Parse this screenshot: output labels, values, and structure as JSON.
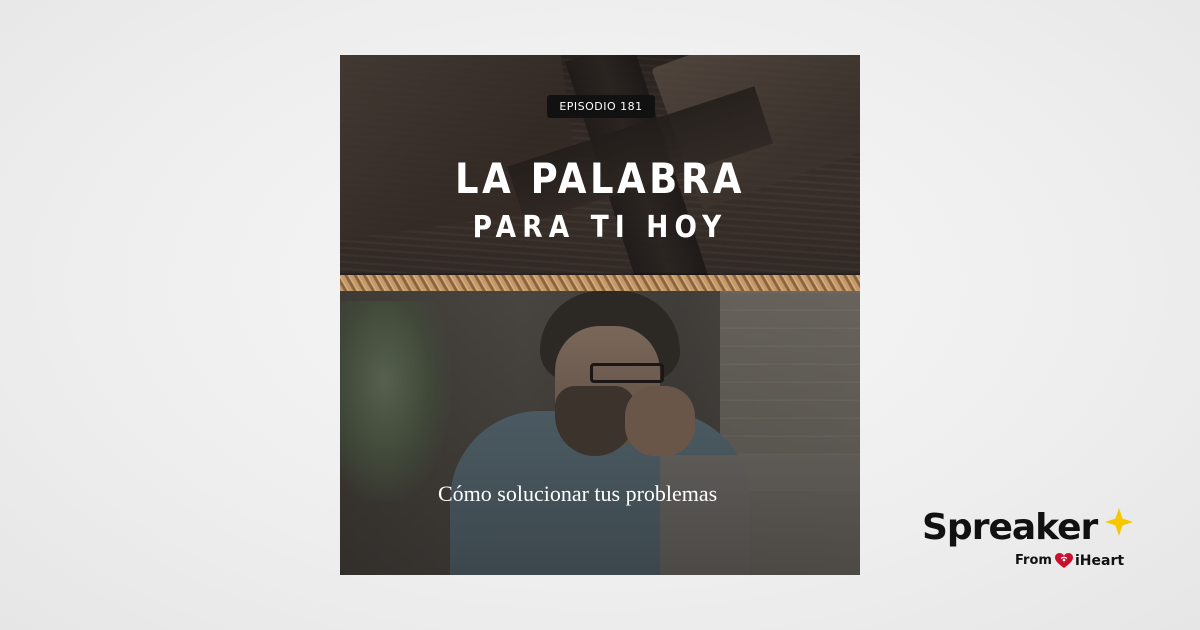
{
  "cover": {
    "episode_label": "EPISODIO 181",
    "title_line1": "LA PALABRA",
    "title_line2": "PARA TI HOY",
    "caption": "Cómo solucionar tus problemas"
  },
  "logo": {
    "brand": "Spreaker",
    "from_label": "From",
    "partner": "iHeart",
    "star_icon": "star-icon",
    "heart_icon": "iheart-heart-icon",
    "star_color": "#f5c800",
    "heart_color": "#c8102e"
  }
}
